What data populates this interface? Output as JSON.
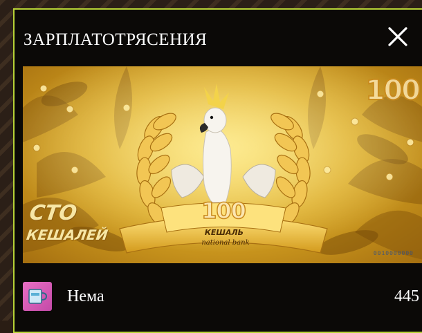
{
  "modal": {
    "title": "ЗАРПЛАТОТРЯСЕНИЯ",
    "close_icon": "close-icon"
  },
  "banknote": {
    "left_text_line1": "СТО",
    "left_text_line2": "КЕШАЛЕЙ",
    "corner_denomination": "100",
    "center_denomination": "100",
    "currency": "КЕШАЛЬ",
    "bank_name": "national bank",
    "serial_number": "0010000000",
    "accent_color": "#d9a623"
  },
  "owner": {
    "avatar_icon": "mug-icon",
    "name": "Нема",
    "value": "445"
  }
}
